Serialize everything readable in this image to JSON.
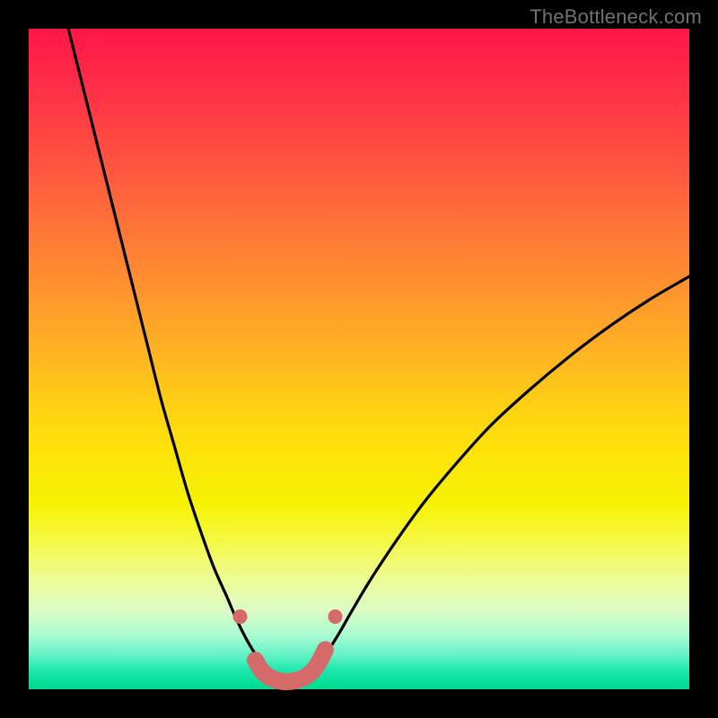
{
  "watermark": "TheBottleneck.com",
  "chart_data": {
    "type": "line",
    "title": "",
    "xlabel": "",
    "ylabel": "",
    "xlim": [
      0,
      100
    ],
    "ylim": [
      0,
      100
    ],
    "background_gradient": {
      "top_color": "#ff1648",
      "mid_color": "#ffe000",
      "bottom_color": "#00da8f"
    },
    "series": [
      {
        "name": "left-curve",
        "stroke": "#000000",
        "x": [
          6,
          8,
          10,
          12,
          14,
          16,
          18,
          20,
          22,
          24,
          26,
          28,
          30,
          31.5,
          33,
          34.5,
          35.8
        ],
        "y": [
          100,
          92,
          84,
          76,
          68,
          60,
          52,
          44,
          37,
          30,
          24,
          18.5,
          14,
          10.5,
          7.5,
          5,
          3
        ]
      },
      {
        "name": "right-curve",
        "stroke": "#000000",
        "x": [
          43.5,
          45,
          47,
          49,
          52,
          56,
          60,
          65,
          70,
          76,
          82,
          88,
          94,
          100
        ],
        "y": [
          3,
          5.3,
          8.5,
          12,
          17,
          23,
          28.5,
          34.5,
          40,
          45.5,
          50.5,
          55,
          59,
          62.5
        ]
      },
      {
        "name": "valley-marker",
        "stroke": "#d46a6a",
        "thick": true,
        "x": [
          34.3,
          35.2,
          36.3,
          37.6,
          39.0,
          40.5,
          41.9,
          43.1,
          44.1,
          44.9
        ],
        "y": [
          4.4,
          2.9,
          1.9,
          1.35,
          1.15,
          1.35,
          1.9,
          2.9,
          4.4,
          6.0
        ]
      }
    ],
    "marker_dots": [
      {
        "x": 32.0,
        "y": 11.0,
        "color": "#d46a6a"
      },
      {
        "x": 46.4,
        "y": 11.0,
        "color": "#d46a6a"
      }
    ]
  }
}
